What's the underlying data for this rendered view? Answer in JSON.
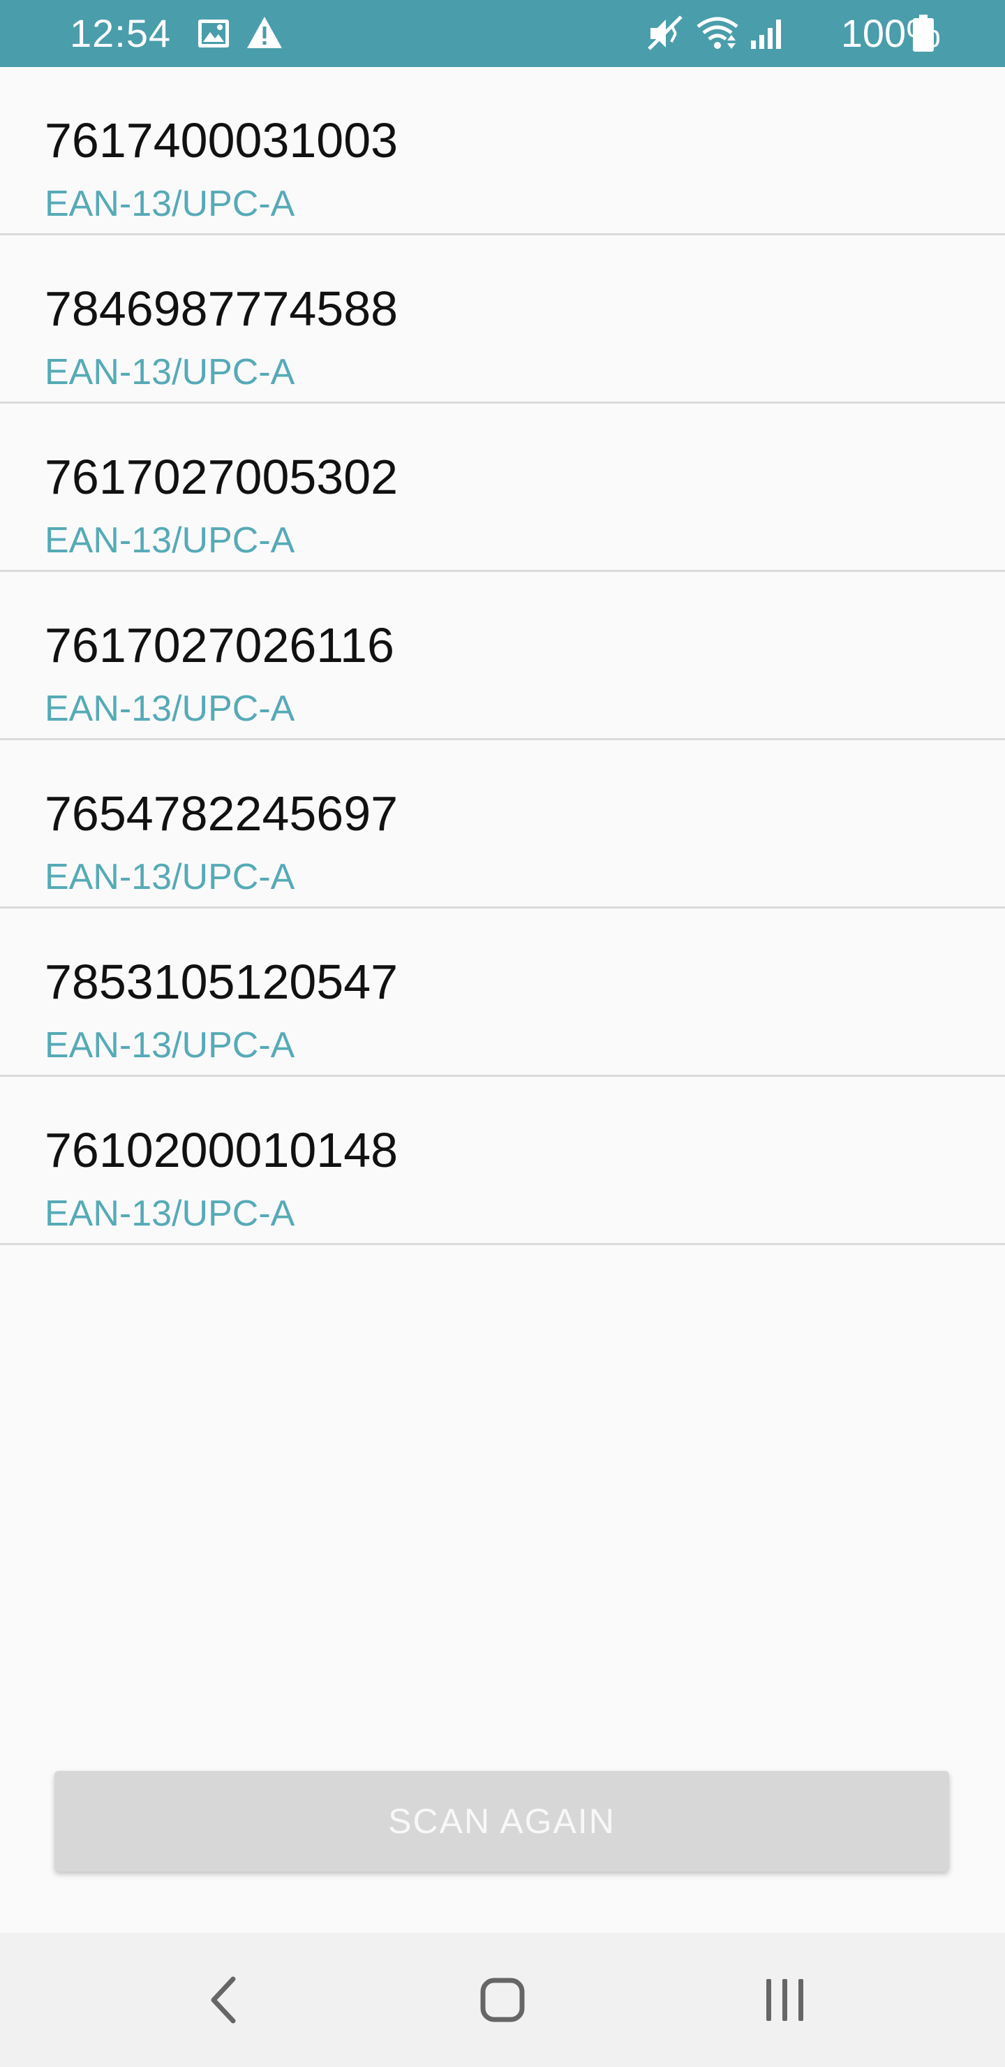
{
  "status_bar": {
    "time": "12:54",
    "battery": "100%",
    "color": "#4a9daa"
  },
  "items": [
    {
      "code": "7617400031003",
      "format": "EAN-13/UPC-A"
    },
    {
      "code": "7846987774588",
      "format": "EAN-13/UPC-A"
    },
    {
      "code": "7617027005302",
      "format": "EAN-13/UPC-A"
    },
    {
      "code": "7617027026116",
      "format": "EAN-13/UPC-A"
    },
    {
      "code": "7654782245697",
      "format": "EAN-13/UPC-A"
    },
    {
      "code": "7853105120547",
      "format": "EAN-13/UPC-A"
    },
    {
      "code": "7610200010148",
      "format": "EAN-13/UPC-A"
    }
  ],
  "scan_button": {
    "label": "SCAN AGAIN",
    "enabled": false
  },
  "nav": {
    "back_icon": "back-icon",
    "home_icon": "home-icon",
    "recents_icon": "recents-icon"
  },
  "colors": {
    "accent": "#56aab7",
    "primary_text": "#111111"
  }
}
